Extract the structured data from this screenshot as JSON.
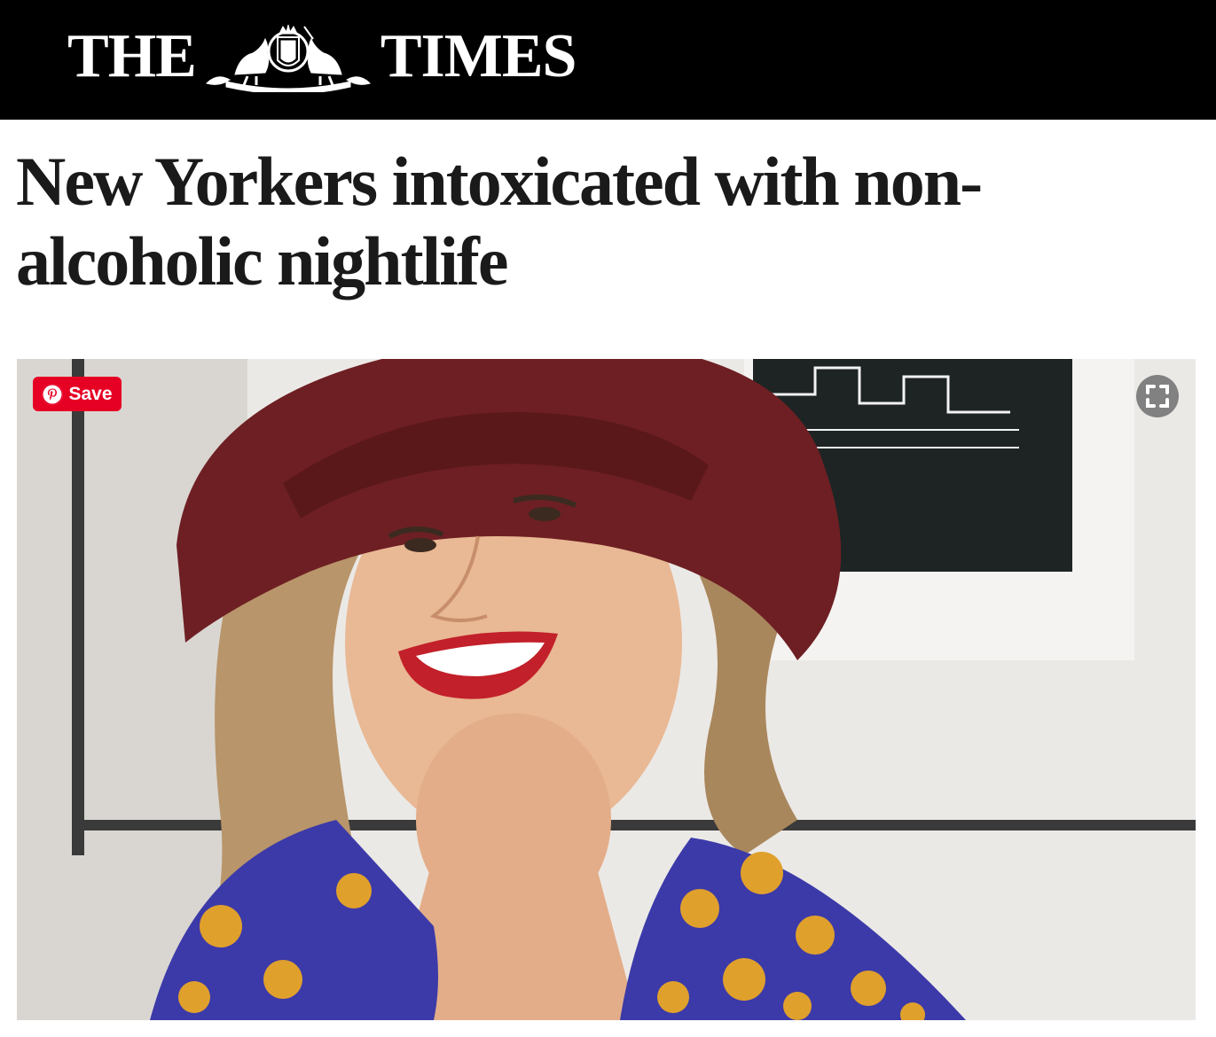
{
  "masthead": {
    "logo_left": "THE",
    "logo_right": "TIMES"
  },
  "article": {
    "headline": "New Yorkers intoxicated with non-alcoholic nightlife"
  },
  "hero_image": {
    "pin_button_label": "Save",
    "pin_icon": "pinterest-icon",
    "expand_icon": "expand-icon"
  },
  "colors": {
    "masthead_bg": "#000000",
    "pin_red": "#e60023",
    "headline_text": "#1a1a1a"
  }
}
